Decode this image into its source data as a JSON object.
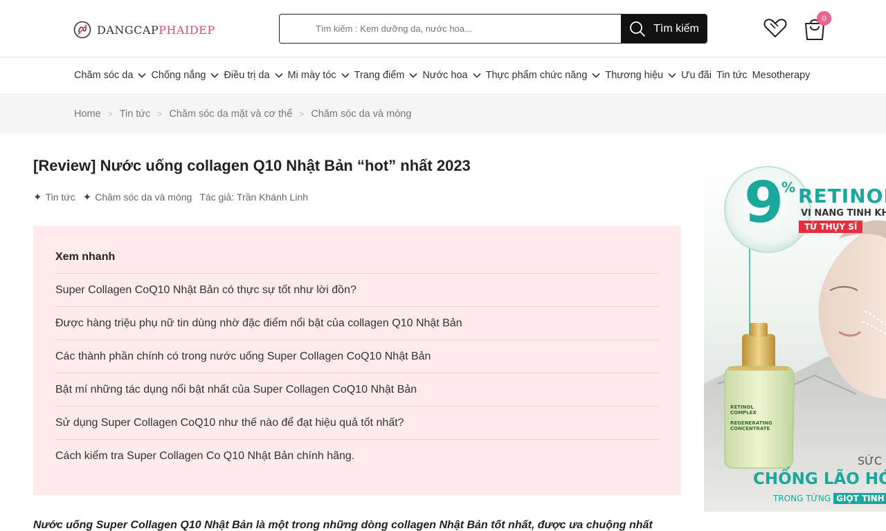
{
  "header": {
    "logo_part1": "DANGCAP",
    "logo_part2": "PHAIDEP",
    "search_placeholder": "Tìm kiếm : Kem dưỡng da, nước hoa...",
    "search_button": "Tìm kiếm",
    "cart_count": "0"
  },
  "nav": {
    "items": [
      {
        "label": "Chăm sóc da",
        "has_dropdown": true
      },
      {
        "label": "Chống nắng",
        "has_dropdown": true
      },
      {
        "label": "Điều trị da",
        "has_dropdown": true
      },
      {
        "label": "Mi mày tóc",
        "has_dropdown": true
      },
      {
        "label": "Trang điểm",
        "has_dropdown": true
      },
      {
        "label": "Nước hoa",
        "has_dropdown": true
      },
      {
        "label": "Thực phẩm chức năng",
        "has_dropdown": true
      },
      {
        "label": "Thương hiệu",
        "has_dropdown": true
      },
      {
        "label": "Ưu đãi",
        "has_dropdown": false
      },
      {
        "label": "Tin tức",
        "has_dropdown": false
      },
      {
        "label": "Mesotherapy",
        "has_dropdown": false
      }
    ]
  },
  "breadcrumb": {
    "items": [
      "Home",
      "Tin tức",
      "Chăm sóc da mặt và cơ thể",
      "Chăm sóc da và móng"
    ],
    "separator": ">"
  },
  "article": {
    "title": "[Review] Nước uống collagen Q10 Nhật Bản “hot” nhất 2023",
    "meta": {
      "category1": "Tin tức",
      "category2": "Chăm sóc da và móng",
      "author_label": "Tác giả:",
      "author": "Trần Khánh Linh"
    },
    "toc": {
      "title": "Xem nhanh",
      "items": [
        "Super Collagen CoQ10 Nhật Bản có thực sự tốt như lời đồn?",
        "Được hàng triệu phụ nữ tin dùng nhờ đặc điểm nổi bật của collagen Q10 Nhật Bản",
        "Các thành phần chính có trong nước uống Super Collagen CoQ10 Nhật Bản",
        "Bật mí những tác dụng nổi bật nhất của Super Collagen CoQ10 Nhật Bản",
        "Sử dụng Super Collagen CoQ10 như thế nào để đạt hiệu quả tốt nhất?",
        "Cách kiểm tra Super Collagen Co Q10 Nhật Bản chính hãng."
      ]
    },
    "intro": "Nước uống Super Collagen Q10 Nhật Bản là một trong những dòng collagen Nhật Bản tốt nhất, được ưa chuộng nhất"
  },
  "ad": {
    "big_number": "9",
    "percent": "%",
    "headline": "RETINOL",
    "subline": "VI NANG TINH KH",
    "origin": "TỪ THỤY SĨ",
    "product_label1": "RETINOL",
    "product_label2": "COMPLEX",
    "product_label3": "REGENERATING",
    "product_label4": "CONCENTRATE",
    "tag_small": "SỨC M",
    "tag_main": "CHỐNG LÃO HÓ",
    "tag_bottom1": "TRONG TỪNG",
    "tag_bottom2": "GIỌT TINH",
    "colors": {
      "teal": "#19a89b",
      "red": "#e52f3c",
      "gold": "#d8b35a"
    }
  },
  "colors": {
    "accent_pink": "#e0487d",
    "badge_pink": "#f06292",
    "toc_bg": "#fdeaea",
    "breadcrumb_bg": "#f5f5f5",
    "search_button_bg": "#111111"
  }
}
